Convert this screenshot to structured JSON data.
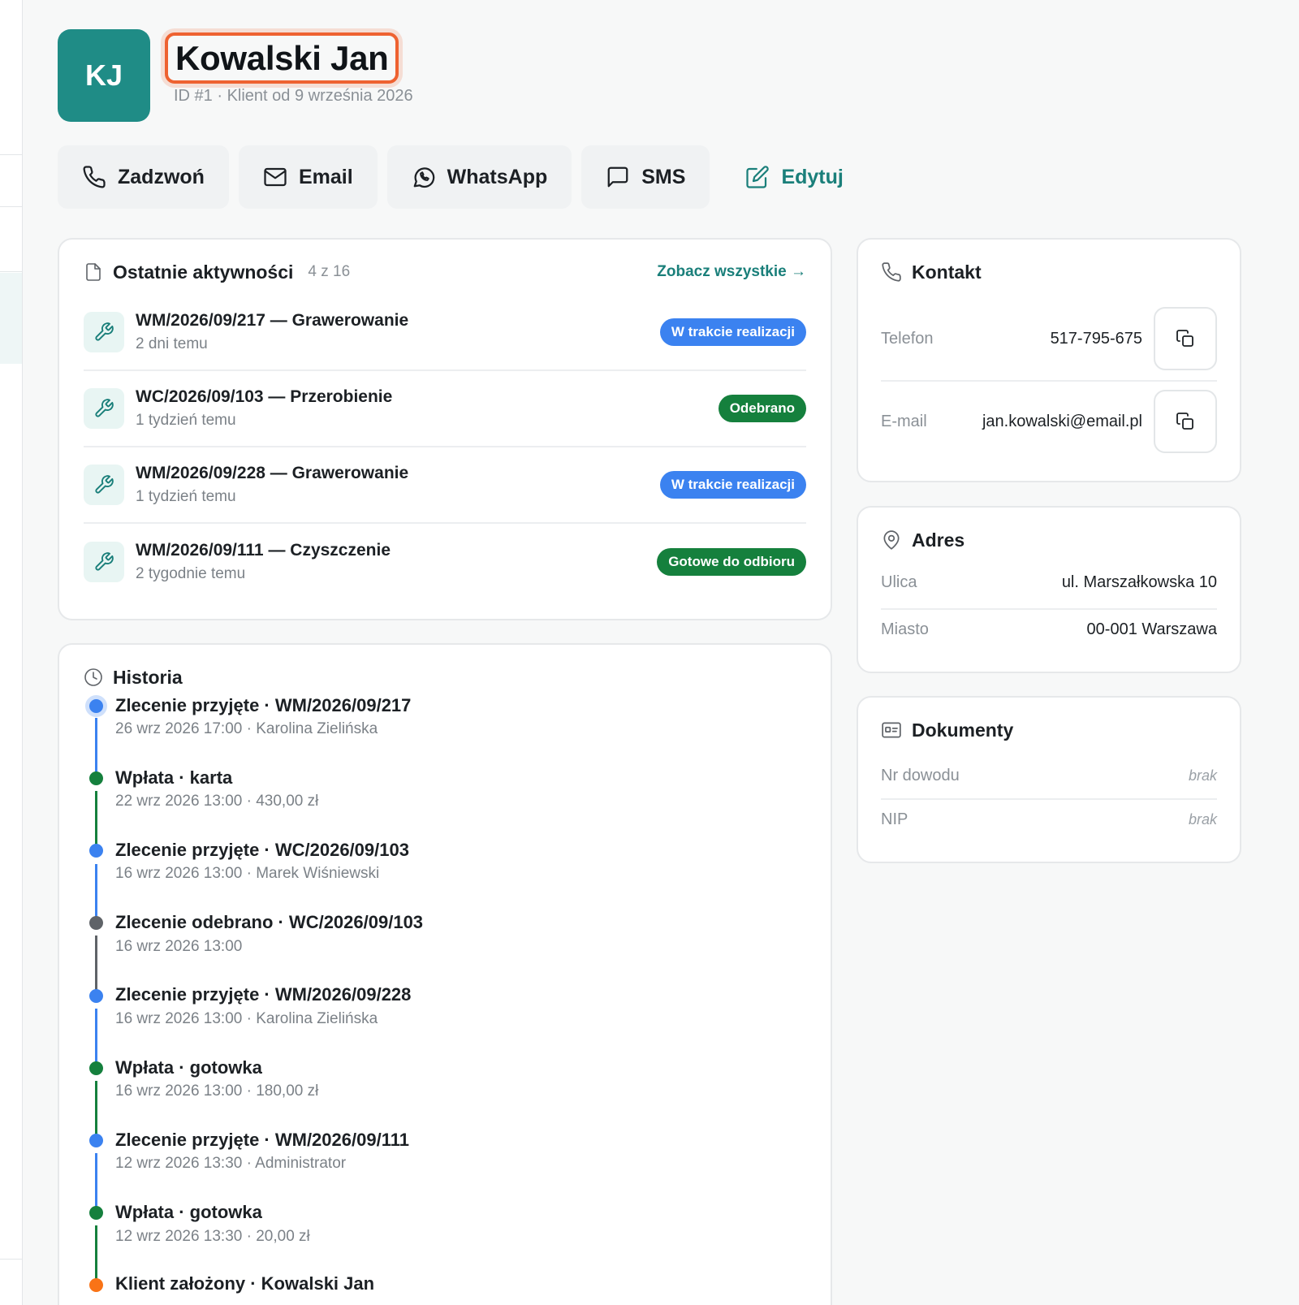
{
  "client": {
    "initials": "KJ",
    "name": "Kowalski Jan",
    "subtitle": "ID #1 · Klient od 9 września 2026"
  },
  "actions": {
    "call": "Zadzwoń",
    "email": "Email",
    "whatsapp": "WhatsApp",
    "sms": "SMS",
    "edit": "Edytuj"
  },
  "activities": {
    "title": "Ostatnie aktywności",
    "count": "4 z 16",
    "see_all": "Zobacz wszystkie →",
    "items": [
      {
        "title": "WM/2026/09/217 — Grawerowanie",
        "time": "2 dni temu",
        "status": "W trakcie realizacji",
        "status_color": "#3b82f0"
      },
      {
        "title": "WC/2026/09/103 — Przerobienie",
        "time": "1 tydzień temu",
        "status": "Odebrano",
        "status_color": "#15803d"
      },
      {
        "title": "WM/2026/09/228 — Grawerowanie",
        "time": "1 tydzień temu",
        "status": "W trakcie realizacji",
        "status_color": "#3b82f0"
      },
      {
        "title": "WM/2026/09/111 — Czyszczenie",
        "time": "2 tygodnie temu",
        "status": "Gotowe do odbioru",
        "status_color": "#15803d"
      }
    ]
  },
  "history": {
    "title": "Historia",
    "events": [
      {
        "title": "Zlecenie przyjęte · WM/2026/09/217",
        "sub": "26 wrz 2026 17:00 · Karolina Zielińska",
        "color": "#3b82f0"
      },
      {
        "title": "Wpłata · karta",
        "sub": "22 wrz 2026 13:00 · 430,00 zł",
        "color": "#15803d"
      },
      {
        "title": "Zlecenie przyjęte · WC/2026/09/103",
        "sub": "16 wrz 2026 13:00 · Marek Wiśniewski",
        "color": "#3b82f0"
      },
      {
        "title": "Zlecenie odebrano · WC/2026/09/103",
        "sub": "16 wrz 2026 13:00",
        "color": "#5f6368"
      },
      {
        "title": "Zlecenie przyjęte · WM/2026/09/228",
        "sub": "16 wrz 2026 13:00 · Karolina Zielińska",
        "color": "#3b82f0"
      },
      {
        "title": "Wpłata · gotowka",
        "sub": "16 wrz 2026 13:00 · 180,00 zł",
        "color": "#15803d"
      },
      {
        "title": "Zlecenie przyjęte · WM/2026/09/111",
        "sub": "12 wrz 2026 13:30 · Administrator",
        "color": "#3b82f0"
      },
      {
        "title": "Wpłata · gotowka",
        "sub": "12 wrz 2026 13:30 · 20,00 zł",
        "color": "#15803d"
      },
      {
        "title": "Klient założony · Kowalski Jan",
        "sub": "",
        "color": "#f97316"
      }
    ]
  },
  "contact": {
    "title": "Kontakt",
    "phone_label": "Telefon",
    "phone": "517-795-675",
    "email_label": "E-mail",
    "email": "jan.kowalski@email.pl"
  },
  "address": {
    "title": "Adres",
    "street_label": "Ulica",
    "street": "ul. Marszałkowska 10",
    "city_label": "Miasto",
    "city": "00-001 Warszawa"
  },
  "documents": {
    "title": "Dokumenty",
    "id_label": "Nr dowodu",
    "id_value": "brak",
    "nip_label": "NIP",
    "nip_value": "brak"
  },
  "colors": {
    "accent": "#1a7f7a",
    "avatar": "#1f8c86",
    "highlight": "#ee6231"
  }
}
